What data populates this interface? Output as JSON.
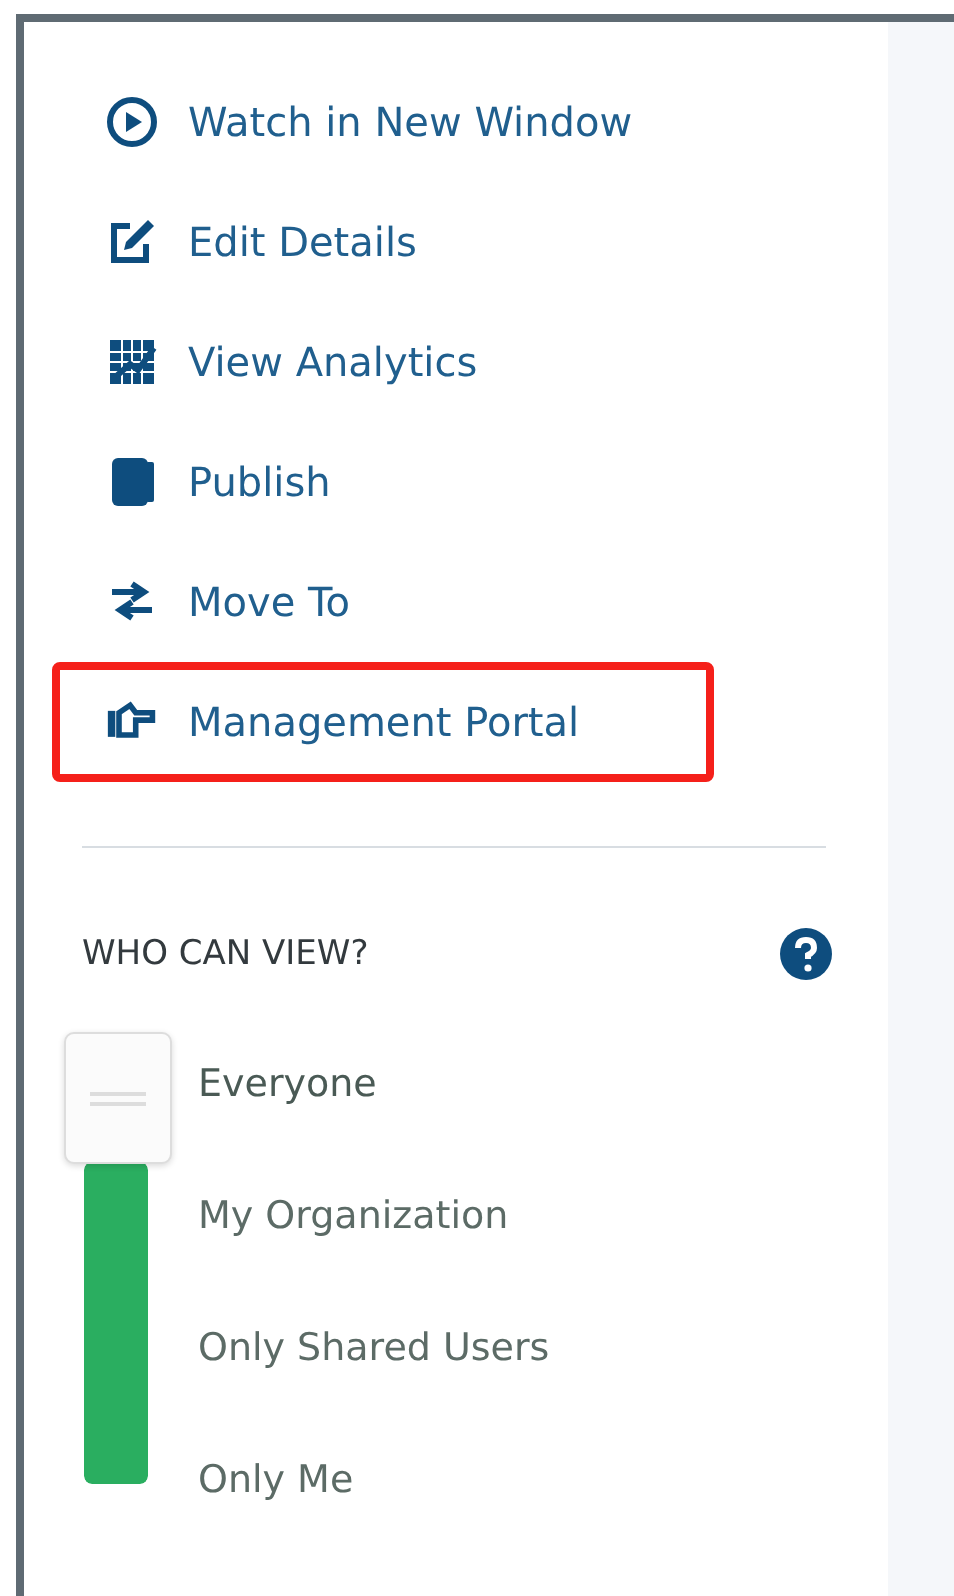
{
  "menu": [
    {
      "kind": "play",
      "label": "Watch in New Window",
      "highlighted": false
    },
    {
      "kind": "edit",
      "label": "Edit Details",
      "highlighted": false
    },
    {
      "kind": "analytics",
      "label": "View Analytics",
      "highlighted": false
    },
    {
      "kind": "publish",
      "label": "Publish",
      "highlighted": false
    },
    {
      "kind": "move",
      "label": "Move To",
      "highlighted": false
    },
    {
      "kind": "hand",
      "label": "Management Portal",
      "highlighted": true
    }
  ],
  "who_can_view": {
    "title": "WHO CAN VIEW?",
    "options": [
      {
        "label": "Everyone",
        "selected": true
      },
      {
        "label": "My Organization",
        "selected": false
      },
      {
        "label": "Only Shared Users",
        "selected": false
      },
      {
        "label": "Only Me",
        "selected": false
      }
    ]
  }
}
